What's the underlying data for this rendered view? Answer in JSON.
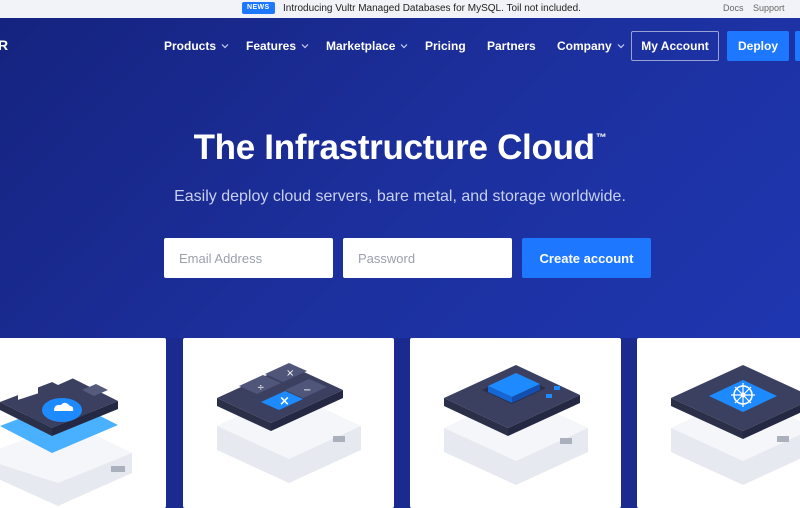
{
  "news": {
    "badge": "NEWS",
    "text": "Introducing Vultr Managed Databases for MySQL. Toil not included."
  },
  "util_links": [
    "Docs",
    "Support"
  ],
  "logo_fragment": "R",
  "nav": {
    "items": [
      {
        "label": "Products",
        "dropdown": true
      },
      {
        "label": "Features",
        "dropdown": true
      },
      {
        "label": "Marketplace",
        "dropdown": true
      },
      {
        "label": "Pricing",
        "dropdown": false
      },
      {
        "label": "Partners",
        "dropdown": false
      },
      {
        "label": "Company",
        "dropdown": true
      }
    ],
    "account_label": "My Account",
    "deploy_label": "Deploy"
  },
  "hero": {
    "title": "The Infrastructure Cloud",
    "trademark": "™",
    "subtitle": "Easily deploy cloud servers, bare metal, and storage worldwide."
  },
  "signup": {
    "email_placeholder": "Email Address",
    "password_placeholder": "Password",
    "submit_label": "Create account"
  },
  "cards": [
    {
      "icon": "cloud-compute-icon"
    },
    {
      "icon": "calculator-icon"
    },
    {
      "icon": "chip-icon"
    },
    {
      "icon": "kubernetes-icon"
    }
  ],
  "colors": {
    "accent": "#1d77ff",
    "hero_bg": "#1a2a8e",
    "newsbar_bg": "#f1f3f8"
  }
}
